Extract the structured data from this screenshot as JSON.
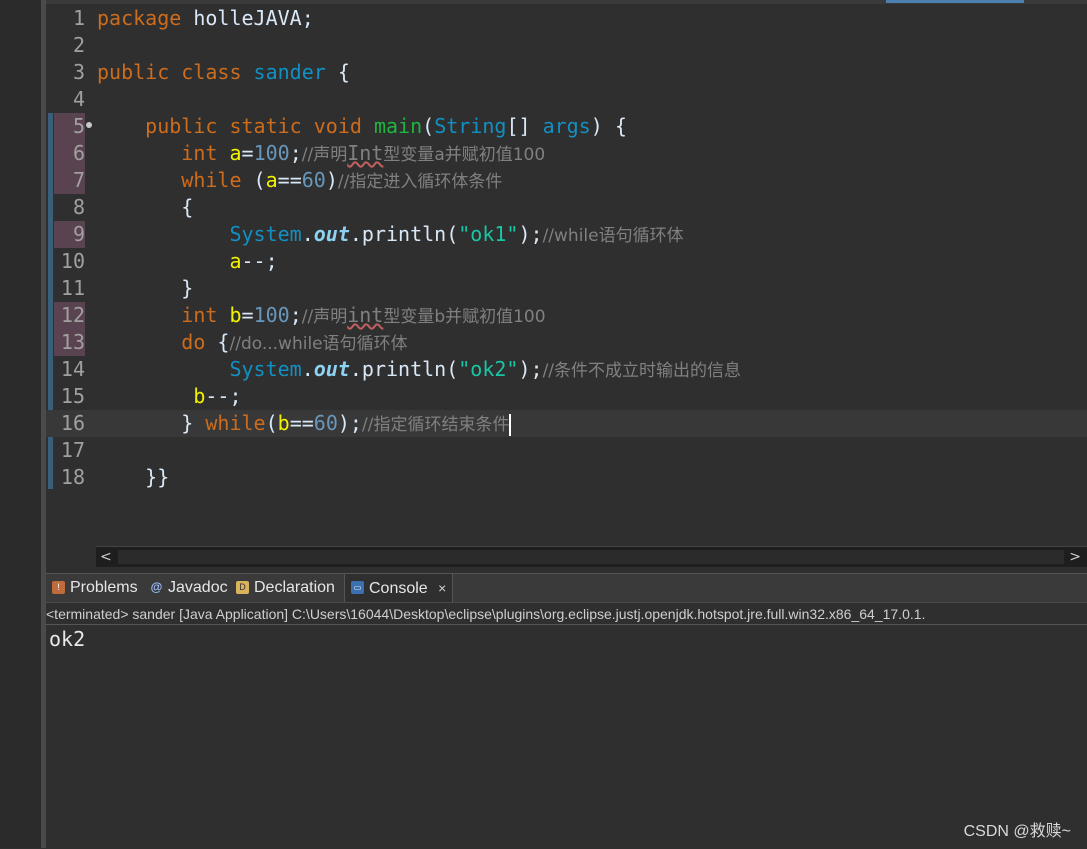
{
  "editor": {
    "lines": [
      {
        "n": "1"
      },
      {
        "n": "2"
      },
      {
        "n": "3"
      },
      {
        "n": "4"
      },
      {
        "n": "5"
      },
      {
        "n": "6"
      },
      {
        "n": "7"
      },
      {
        "n": "8"
      },
      {
        "n": "9"
      },
      {
        "n": "10"
      },
      {
        "n": "11"
      },
      {
        "n": "12"
      },
      {
        "n": "13"
      },
      {
        "n": "14"
      },
      {
        "n": "15"
      },
      {
        "n": "16"
      },
      {
        "n": "17"
      },
      {
        "n": "18"
      }
    ],
    "tokens": {
      "l1_kw": "package",
      "l1_rest": " holleJAVA;",
      "l3_kw": "public class",
      "l3_name": "sander",
      "l3_rest": " {",
      "l5_kw": "public static void",
      "l5_fn": "main",
      "l5_p1": "(",
      "l5_typ": "String",
      "l5_p2": "[] ",
      "l5_arg": "args",
      "l5_p3": ") {",
      "l6_kw": "int",
      "l6_var": "a",
      "l6_eq": "=",
      "l6_num": "100",
      "l6_semi": ";",
      "l6_cmt1": "//声明",
      "l6_cmt_sq": "Int",
      "l6_cmt2": "型变量a并赋初值100",
      "l7_kw": "while",
      "l7_p1": " (",
      "l7_var": "a",
      "l7_eq": "==",
      "l7_num": "60",
      "l7_p2": ")",
      "l7_cmt": "//指定进入循环体条件",
      "l8_brace": "{",
      "l9_sys": "System",
      "l9_dot1": ".",
      "l9_out": "out",
      "l9_dot2": ".println(",
      "l9_str": "\"ok1\"",
      "l9_end": ");",
      "l9_cmt": "//while语句循环体",
      "l10_var": "a",
      "l10_rest": "--;",
      "l11_brace": "}",
      "l12_kw": "int",
      "l12_var": "b",
      "l12_eq": "=",
      "l12_num": "100",
      "l12_semi": ";",
      "l12_cmt1": "//声明",
      "l12_cmt_sq": "int",
      "l12_cmt2": "型变量b并赋初值100",
      "l13_kw": "do",
      "l13_brace": " {",
      "l13_cmt": "//do...while语句循环体",
      "l14_sys": "System",
      "l14_dot1": ".",
      "l14_out": "out",
      "l14_dot2": ".println(",
      "l14_str": "\"ok2\"",
      "l14_end": ");",
      "l14_cmt": "//条件不成立时输出的信息",
      "l15_var": "b",
      "l15_rest": "--;",
      "l16_brace": "} ",
      "l16_kw": "while",
      "l16_p1": "(",
      "l16_var": "b",
      "l16_eq": "==",
      "l16_num": "60",
      "l16_p2": ");",
      "l16_cmt": "//指定循环结束条件",
      "l18_brace": "}}"
    }
  },
  "scrollbar": {
    "left": "<",
    "right": ">"
  },
  "panel": {
    "tabs": [
      {
        "label": "Problems",
        "icon": "problems-icon",
        "glyph": "!"
      },
      {
        "label": "Javadoc",
        "icon": "javadoc-icon",
        "glyph": "@"
      },
      {
        "label": "Declaration",
        "icon": "declaration-icon",
        "glyph": "D"
      },
      {
        "label": "Console",
        "icon": "console-icon",
        "glyph": "▭",
        "close": "×"
      }
    ],
    "status": "<terminated> sander [Java Application] C:\\Users\\16044\\Desktop\\eclipse\\plugins\\org.eclipse.justj.openjdk.hotspot.jre.full.win32.x86_64_17.0.1.",
    "output": "ok2"
  },
  "watermark": "CSDN @救赎~",
  "colors": {
    "keyword": "#cc6c1d",
    "type": "#1290c3",
    "string": "#17c6a3",
    "comment": "#808080",
    "variable": "#f2f200",
    "number": "#6897bb"
  }
}
